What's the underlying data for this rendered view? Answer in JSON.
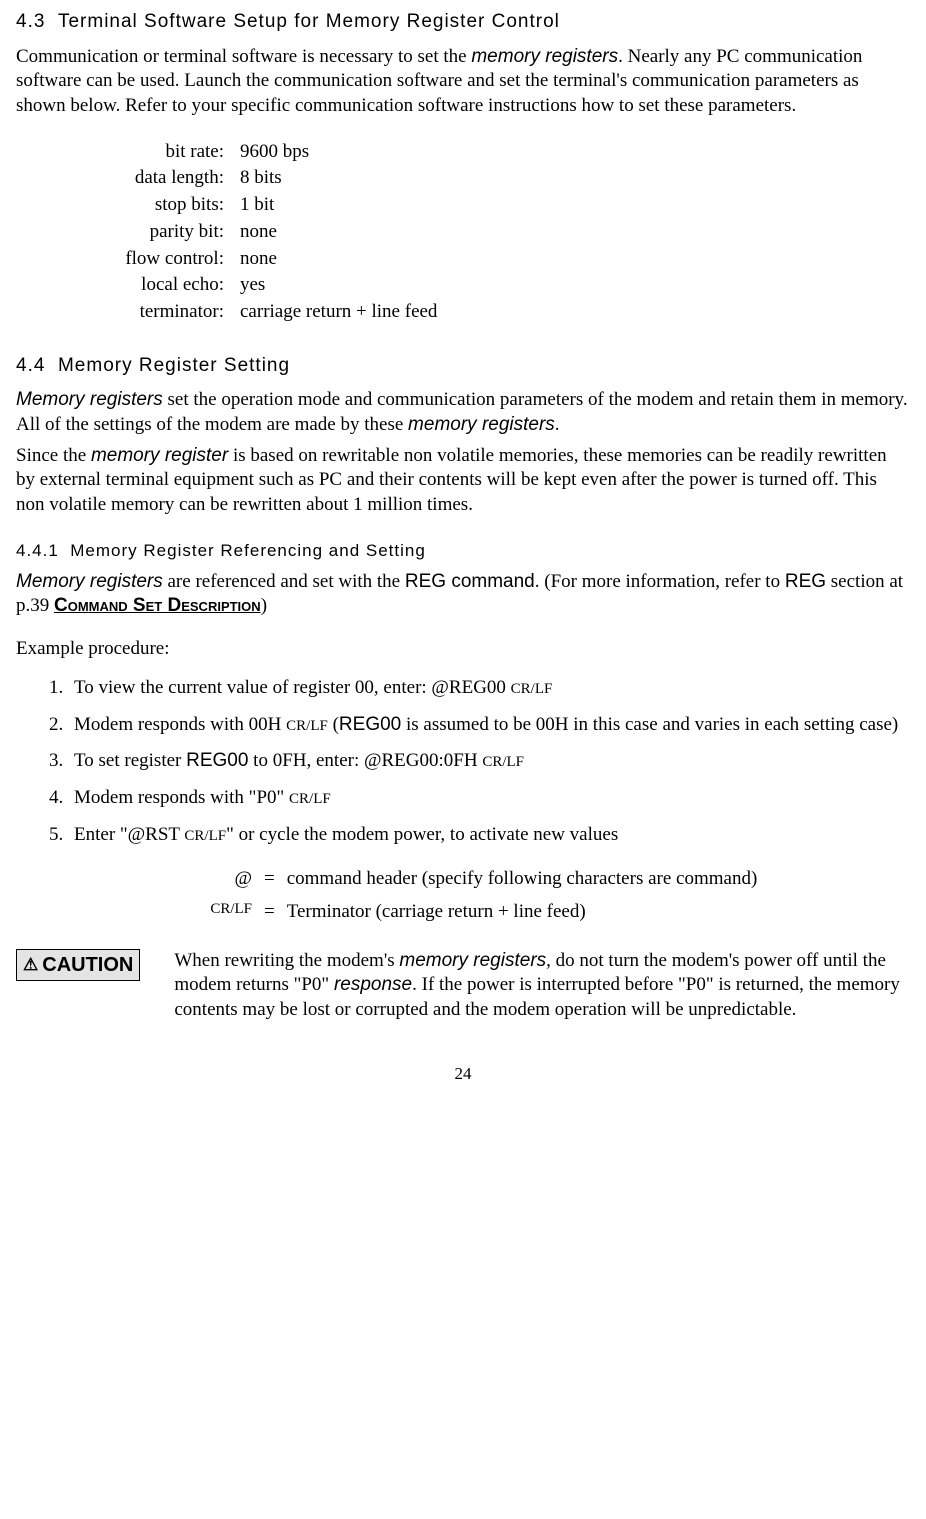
{
  "section43": {
    "num": "4.3",
    "title": "Terminal Software Setup for Memory Register Control",
    "body_a": "Communication or terminal software is necessary to set the ",
    "body_term": "memory registers",
    "body_b": ". Nearly any PC communication software can be used. Launch the communication software and set the terminal's communication parameters as shown below. Refer to your specific communication software instructions how to set these parameters.",
    "params": [
      {
        "label": "bit rate:",
        "value": "9600 bps"
      },
      {
        "label": "data length:",
        "value": "8 bits"
      },
      {
        "label": "stop bits:",
        "value": "1 bit"
      },
      {
        "label": "parity bit:",
        "value": "none"
      },
      {
        "label": "flow control:",
        "value": "none"
      },
      {
        "label": "local echo:",
        "value": "yes"
      },
      {
        "label": "terminator:",
        "value": "carriage return + line feed"
      }
    ]
  },
  "section44": {
    "num": "4.4",
    "title": "Memory Register Setting",
    "p1_term1": "Memory registers",
    "p1_a": " set the operation mode and communication parameters of the modem and retain them in memory. All of the settings of the modem are made by these ",
    "p1_term2": "memory registers",
    "p1_b": ".",
    "p2_a": "Since the ",
    "p2_term": "memory register",
    "p2_b": " is based on rewritable non volatile memories, these memories can be readily rewritten by external terminal equipment such as PC and their contents will be kept even after the power is turned off. This non volatile memory can be rewritten about 1 million times."
  },
  "section441": {
    "num": "4.4.1",
    "title": "Memory Register Referencing and Setting",
    "p1_term": "Memory registers",
    "p1_a": " are referenced and set with the ",
    "p1_cmd": "REG command",
    "p1_b": ". (For more information, refer to ",
    "p1_reg": "REG",
    "p1_c": " section at p.39 ",
    "p1_smallcaps": "Command Set Description",
    "p1_d": ")",
    "example_label": "Example procedure:",
    "steps": {
      "s1_a": "To view the current value of register 00, enter: ",
      "s1_cmd": "@REG00 ",
      "s1_crlf": "CR/LF",
      "s2_a": "Modem responds with 00H ",
      "s2_crlf": "CR/LF",
      "s2_b": " (",
      "s2_reg": "REG00",
      "s2_c": " is assumed to be 00H in this case and varies in each setting case)",
      "s3_a": "To set register ",
      "s3_reg": "REG00",
      "s3_b": " to 0FH, enter: ",
      "s3_cmd": "@REG00:0FH ",
      "s3_crlf": "CR/LF",
      "s4_a": "Modem responds with \"P0\" ",
      "s4_crlf": "CR/LF",
      "s5_a": "Enter \"",
      "s5_cmd": "@RST ",
      "s5_crlf": "CR/LF",
      "s5_b": "\" or cycle the modem power, to activate new values"
    },
    "legend": [
      {
        "sym": "@",
        "eq": "=",
        "desc": "command header (specify following characters are command)"
      },
      {
        "sym": "CR/LF",
        "eq": "=",
        "desc": "Terminator (carriage return + line feed)"
      }
    ]
  },
  "caution": {
    "label": "CAUTION",
    "a": "When rewriting the modem's ",
    "term1": "memory registers",
    "b": ", do not turn the modem's power off until the modem returns \"P0\" ",
    "term2": "response",
    "c": ". If the power is interrupted before \"P0\" is returned, the memory contents may be lost or corrupted and the modem operation will be unpredictable."
  },
  "page_number": "24"
}
